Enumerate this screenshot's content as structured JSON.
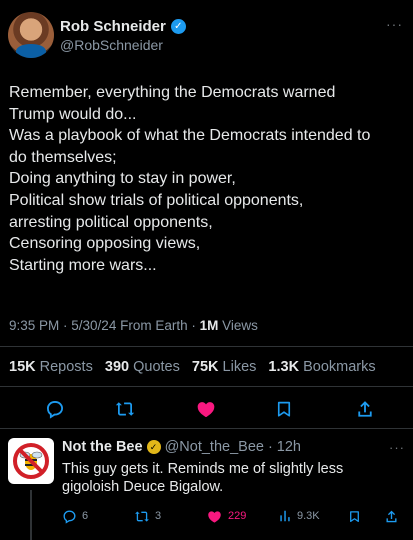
{
  "author": {
    "name": "Rob Schneider",
    "handle": "@RobSchneider",
    "more_label": "···"
  },
  "tweet": {
    "lines": [
      "Remember, everything the Democrats warned",
      "Trump would do...",
      "Was a playbook of what the Democrats intended to",
      "do themselves;",
      "Doing anything to stay in power,",
      "Political show trials of political opponents,",
      "arresting political opponents,",
      "Censoring opposing views,",
      "Starting more wars..."
    ],
    "time": "9:35 PM",
    "date": "5/30/24",
    "source": "From Earth",
    "views_count": "1M",
    "views_label": "Views"
  },
  "stats": {
    "reposts_count": "15K",
    "reposts_label": "Reposts",
    "quotes_count": "390",
    "quotes_label": "Quotes",
    "likes_count": "75K",
    "likes_label": "Likes",
    "bookmarks_count": "1.3K",
    "bookmarks_label": "Bookmarks"
  },
  "actions": {
    "icons": [
      "reply-icon",
      "repost-icon",
      "like-icon",
      "bookmark-icon",
      "share-icon"
    ],
    "like_color": "#f91880",
    "icon_color": "#1d9bf0"
  },
  "reply": {
    "name": "Not the Bee",
    "handle": "@Not_the_Bee",
    "separator": "·",
    "time": "12h",
    "more_label": "···",
    "lines": [
      "This guy gets it. Reminds me of slightly less",
      "gigoloish Deuce Bigalow."
    ],
    "replies": "6",
    "reposts": "3",
    "likes": "229",
    "views": "9.3K"
  }
}
